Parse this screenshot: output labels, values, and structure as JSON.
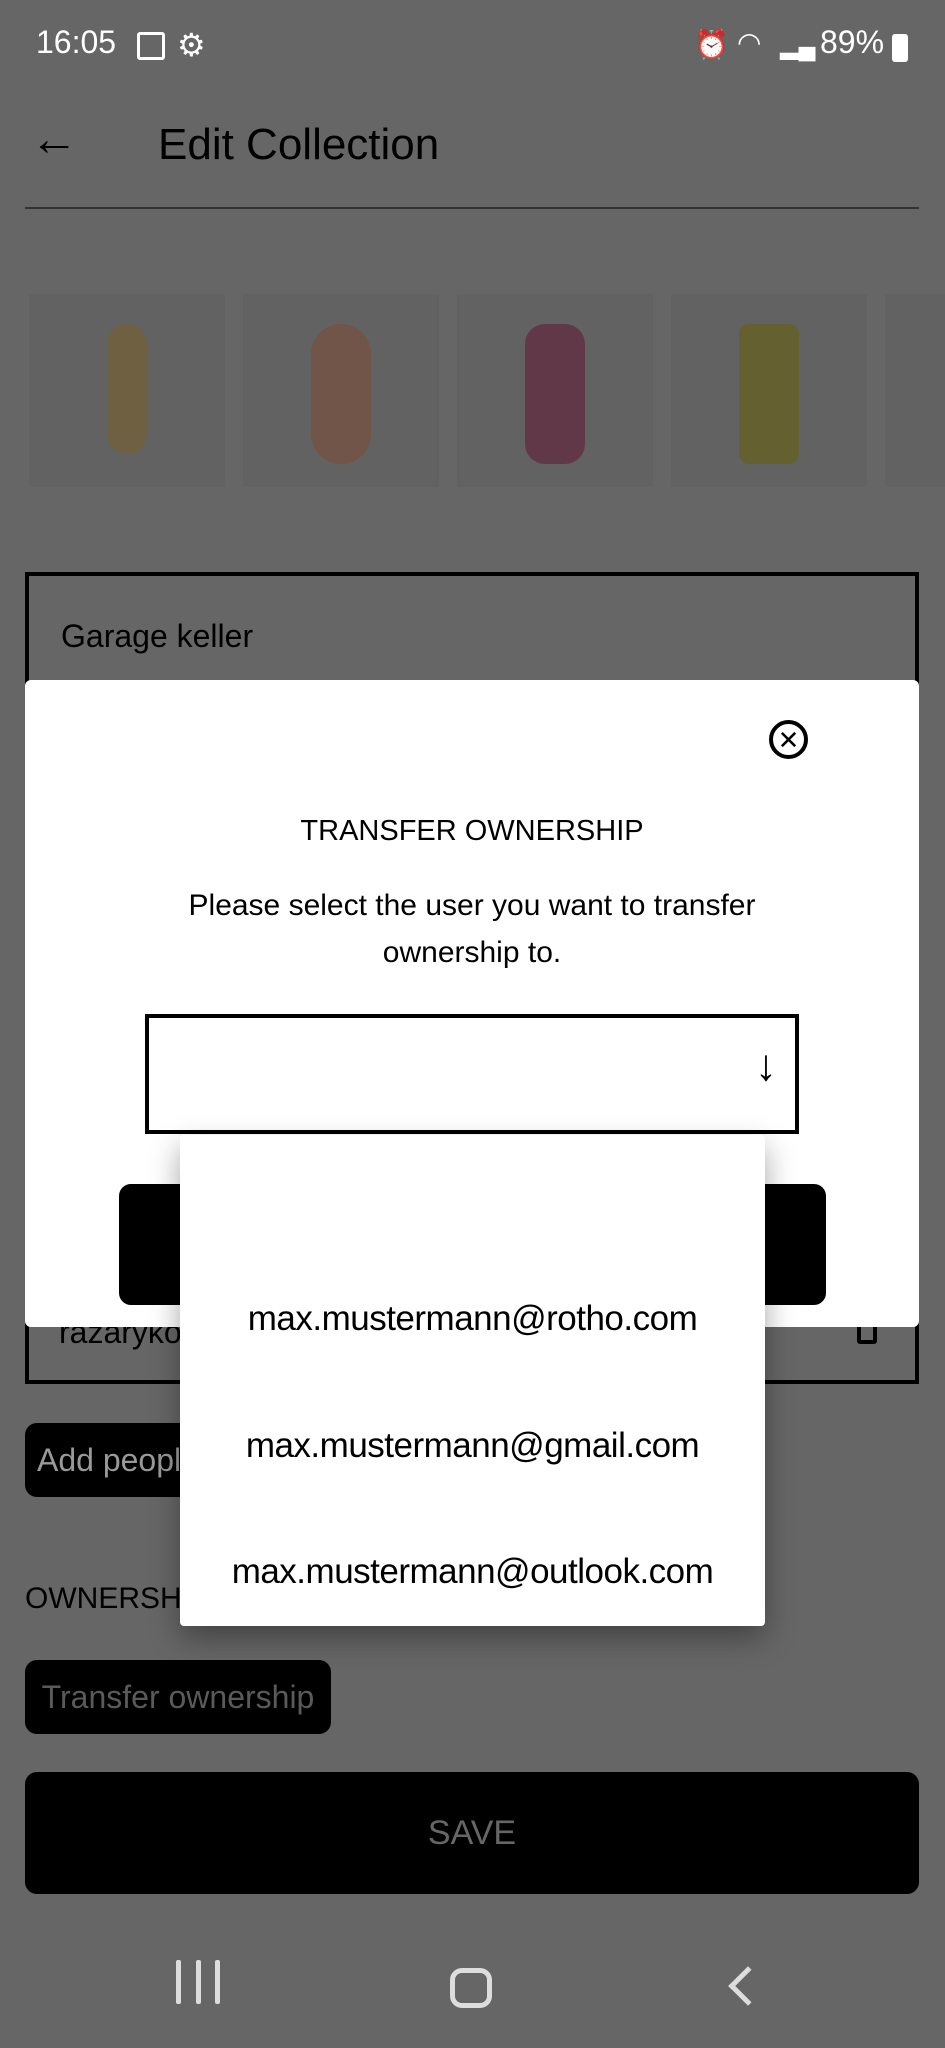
{
  "status_bar": {
    "time": "16:05",
    "battery": "89%",
    "icons": [
      "image-icon",
      "gear-icon",
      "alarm-icon",
      "wifi-icon",
      "signal-icon",
      "battery-icon"
    ]
  },
  "header": {
    "title": "Edit Collection",
    "back_icon": "arrow-left-icon"
  },
  "collection": {
    "name": "Garage keller"
  },
  "members": [
    {
      "name": "razaryko"
    }
  ],
  "add_people_label": "Add people",
  "ownership_label": "OWNERSHIP",
  "transfer_button_label": "Transfer ownership",
  "save_label": "SAVE",
  "modal": {
    "title": "TRANSFER OWNERSHIP",
    "description": "Please select the user you want to transfer ownership to.",
    "select_value": "",
    "options": [
      "",
      "max.mustermann@rotho.com",
      "max.mustermann@gmail.com",
      "max.mustermann@outlook.com"
    ]
  },
  "nav": {
    "icons": [
      "recent-apps-icon",
      "home-icon",
      "back-icon"
    ]
  },
  "colors": {
    "overlay": "#666666",
    "button": "#000000"
  }
}
